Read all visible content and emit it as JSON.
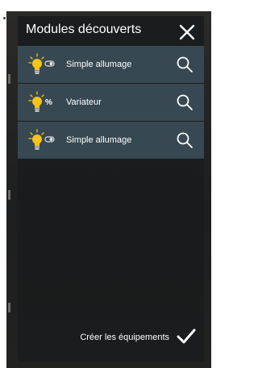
{
  "dialog": {
    "title": "Modules découverts"
  },
  "modules": [
    {
      "label": "Simple allumage",
      "type_icon": "switch-toggle-icon"
    },
    {
      "label": "Variateur",
      "type_icon": "percent-dimmer-icon",
      "type_symbol": "%"
    },
    {
      "label": "Simple allumage",
      "type_icon": "switch-toggle-icon"
    }
  ],
  "footer": {
    "create_label": "Créer les équipements"
  },
  "colors": {
    "panel": "#1a1c1d",
    "row": "#374852",
    "bulb": "#f6c31a",
    "text": "#ffffff"
  }
}
